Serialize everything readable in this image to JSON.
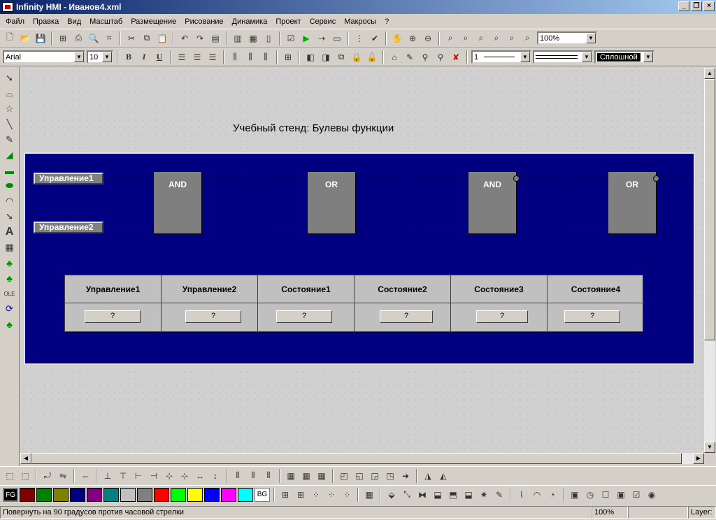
{
  "window": {
    "title": "Infinity HMI - Иванов4.xml"
  },
  "menu": [
    "Файл",
    "Правка",
    "Вид",
    "Масштаб",
    "Размещение",
    "Рисование",
    "Динамика",
    "Проект",
    "Сервис",
    "Макросы",
    "?"
  ],
  "toolbar": {
    "zoom": "100%",
    "font_name": "Arial",
    "font_size": "10",
    "bold": "B",
    "italic": "I",
    "underline": "U",
    "line_width": "1",
    "fill_style": "Сплошной"
  },
  "canvas": {
    "title": "Учебный стенд: Булевы функции",
    "controls": [
      "Управление1",
      "Управление2"
    ],
    "gates": [
      "AND",
      "OR",
      "AND",
      "OR"
    ],
    "table": {
      "headers": [
        "Управление1",
        "Управление2",
        "Состояние1",
        "Состояние2",
        "Состояние3",
        "Состояние4"
      ],
      "values": [
        "?",
        "?",
        "?",
        "?",
        "?",
        "?"
      ]
    }
  },
  "palette": {
    "fg_label": "FG",
    "bg_label": "BG",
    "colors": [
      "#800000",
      "#008000",
      "#808000",
      "#000080",
      "#800080",
      "#008080",
      "#c0c0c0",
      "#808080",
      "#ff0000",
      "#00ff00",
      "#ffff00",
      "#0000ff",
      "#ff00ff",
      "#00ffff"
    ]
  },
  "status": {
    "hint": "Повернуть на 90 градусов против часовой стрелки",
    "zoom": "100%",
    "layer": "Layer:"
  }
}
